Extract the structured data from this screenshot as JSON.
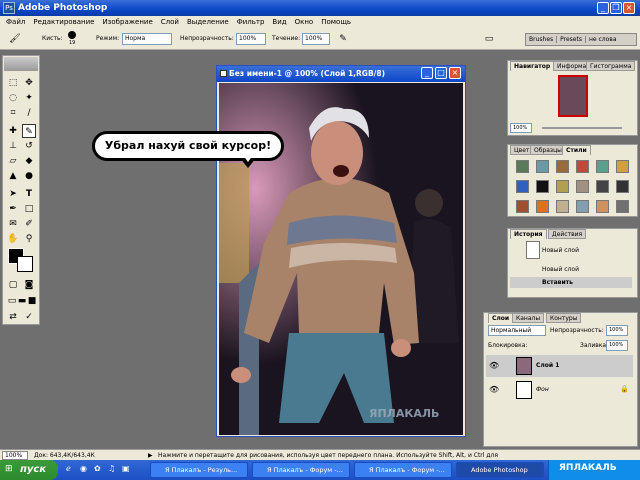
{
  "app": {
    "title": "Adobe Photoshop",
    "logo": "Ps"
  },
  "menu": [
    "Файл",
    "Редактирование",
    "Изображение",
    "Слой",
    "Выделение",
    "Фильтр",
    "Вид",
    "Окно",
    "Помощь"
  ],
  "options": {
    "brush_label": "Кисть:",
    "brush_size": "19",
    "mode_label": "Режим:",
    "mode_value": "Норма",
    "opacity_label": "Непрозрачность:",
    "opacity_value": "100%",
    "flow_label": "Течение:",
    "flow_value": "100%"
  },
  "palette_well": {
    "brushes": "Brushes",
    "presets": "Presets",
    "other": "не слова"
  },
  "document": {
    "title": "Без имени-1 @ 100% (Слой 1,RGB/8)",
    "bubble_text": "Убрал нахуй свой курсор!",
    "watermark": "ЯПЛАКАЛЬ"
  },
  "navigator": {
    "tabs": [
      "Навигатор",
      "Информация",
      "Гистограмма"
    ],
    "zoom": "100%"
  },
  "swatches": {
    "tabs": [
      "Цвет",
      "Образцы",
      "Стили"
    ]
  },
  "history": {
    "tabs": [
      "История",
      "Действия"
    ],
    "items": [
      "Новый слой",
      "Новый слой",
      "Вставить"
    ]
  },
  "layers": {
    "tabs": [
      "Слои",
      "Каналы",
      "Контуры"
    ],
    "blend": "Нормальный",
    "opacity_label": "Непрозрачность:",
    "opacity_value": "100%",
    "lock_label": "Блокировка:",
    "fill_label": "Заливка:",
    "fill_value": "100%",
    "items": [
      "Слой 1",
      "Фон"
    ]
  },
  "status": {
    "zoom": "100%",
    "doc": "Док: 643,4К/643,4К",
    "hint": "Нажмите и перетащите для рисования, используя цвет переднего плана. Используйте Shift, Alt, и Ctrl для"
  },
  "taskbar": {
    "start": "пуск",
    "tasks": [
      "Я Плакалъ - Резуль...",
      "Я Плакалъ - Форум -...",
      "Я Плакалъ - Форум -...",
      "Adobe Photoshop"
    ],
    "tray_text": "ЯПЛАКАЛЬ"
  },
  "colors": {
    "title_blue": "#0a46c8",
    "start_green": "#2d8a2d"
  }
}
